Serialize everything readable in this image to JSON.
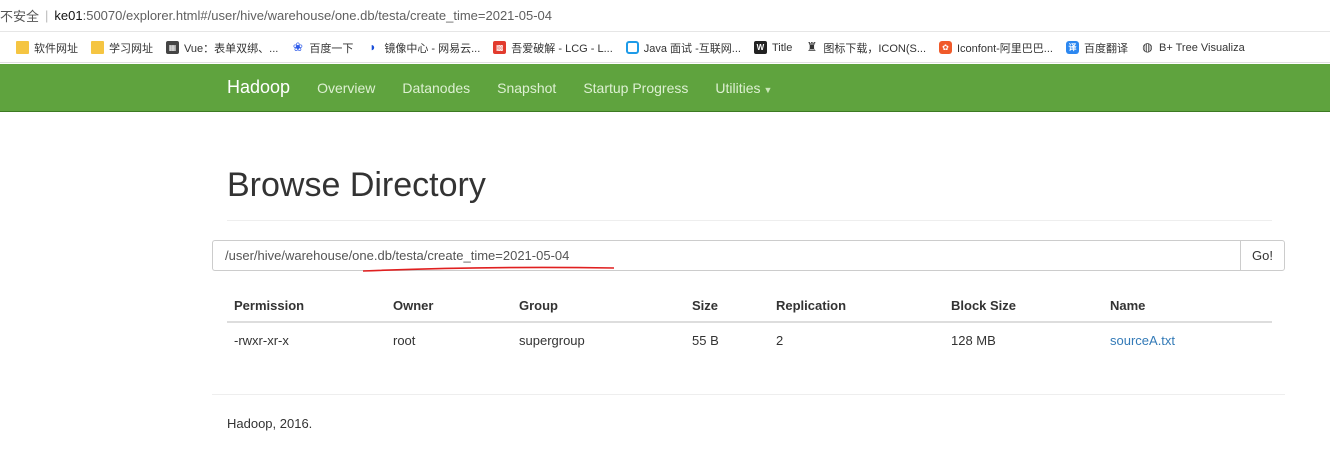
{
  "browser": {
    "insecure_label": "不安全",
    "separator": "|",
    "url_host": "ke01",
    "url_rest": ":50070/explorer.html#/user/hive/warehouse/one.db/testa/create_time=2021-05-04"
  },
  "bookmarks": [
    {
      "label": "软件网址",
      "icon": "folder-icon"
    },
    {
      "label": "学习网址",
      "icon": "folder-icon"
    },
    {
      "label": "Vue：表单双绑、...",
      "icon": "vue-icon"
    },
    {
      "label": "百度一下",
      "icon": "baidu-paw-icon"
    },
    {
      "label": "镜像中心 - 网易云...",
      "icon": "mirror-icon"
    },
    {
      "label": "吾爱破解 - LCG - L...",
      "icon": "crack-icon"
    },
    {
      "label": "Java 面试 -互联网...",
      "icon": "tv-icon"
    },
    {
      "label": "Title",
      "icon": "ws-icon"
    },
    {
      "label": "图标下载，ICON(S...",
      "icon": "icon-site-icon"
    },
    {
      "label": "Iconfont-阿里巴巴...",
      "icon": "iconfont-icon"
    },
    {
      "label": "百度翻译",
      "icon": "translate-icon"
    },
    {
      "label": "B+ Tree Visualiza",
      "icon": "globe-icon"
    }
  ],
  "navbar": {
    "brand": "Hadoop",
    "items": [
      "Overview",
      "Datanodes",
      "Snapshot",
      "Startup Progress",
      "Utilities"
    ],
    "color": "#5fa33e"
  },
  "main": {
    "title": "Browse Directory",
    "path_value": "/user/hive/warehouse/one.db/testa/create_time=2021-05-04",
    "go_label": "Go!",
    "annotation_color": "#e02020"
  },
  "table": {
    "columns": [
      "Permission",
      "Owner",
      "Group",
      "Size",
      "Replication",
      "Block Size",
      "Name"
    ],
    "rows": [
      {
        "permission": "-rwxr-xr-x",
        "owner": "root",
        "group": "supergroup",
        "size": "55 B",
        "replication": "2",
        "block_size": "128 MB",
        "name": "sourceA.txt"
      }
    ]
  },
  "footer": {
    "text": "Hadoop, 2016."
  }
}
